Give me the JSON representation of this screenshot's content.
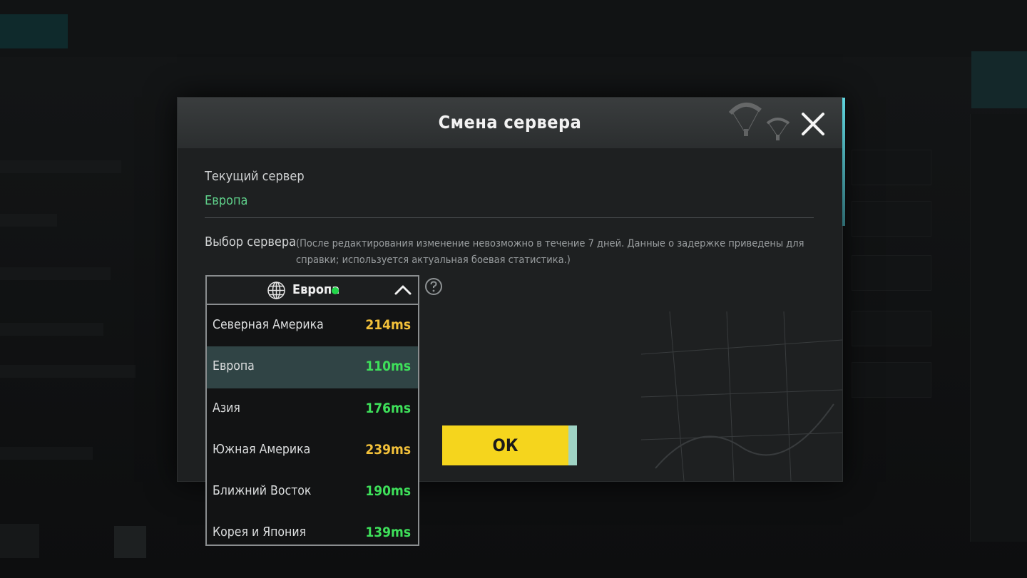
{
  "modal": {
    "title": "Смена сервера",
    "current_server_label": "Текущий сервер",
    "current_server_value": "Европа",
    "select_server_label": "Выбор сервера",
    "note": "(После редактирования изменение невозможно в течение 7 дней. Данные о задержке приведены для справки; используется актуальная боевая статистика.)",
    "ok_label": "ОК"
  },
  "dropdown": {
    "selected": "Европа",
    "items": [
      {
        "name": "Северная Америка",
        "ping": "214ms",
        "level": "high"
      },
      {
        "name": "Европа",
        "ping": "110ms",
        "level": "good"
      },
      {
        "name": "Азия",
        "ping": "176ms",
        "level": "good"
      },
      {
        "name": "Южная Америка",
        "ping": "239ms",
        "level": "high"
      },
      {
        "name": "Ближний Восток",
        "ping": "190ms",
        "level": "good"
      },
      {
        "name": "Корея и Япония",
        "ping": "139ms",
        "level": "good"
      }
    ]
  },
  "colors": {
    "ok_button": "#f5d51d",
    "current_server": "#5fd08a",
    "ping_high": "#f3c13a",
    "ping_good": "#3ee05a",
    "selected_row": "#304445",
    "online_dot": "#22d64a"
  },
  "icons": {
    "close": "close-icon",
    "globe": "globe-icon",
    "chevron": "chevron-up-icon",
    "help": "help-icon"
  }
}
